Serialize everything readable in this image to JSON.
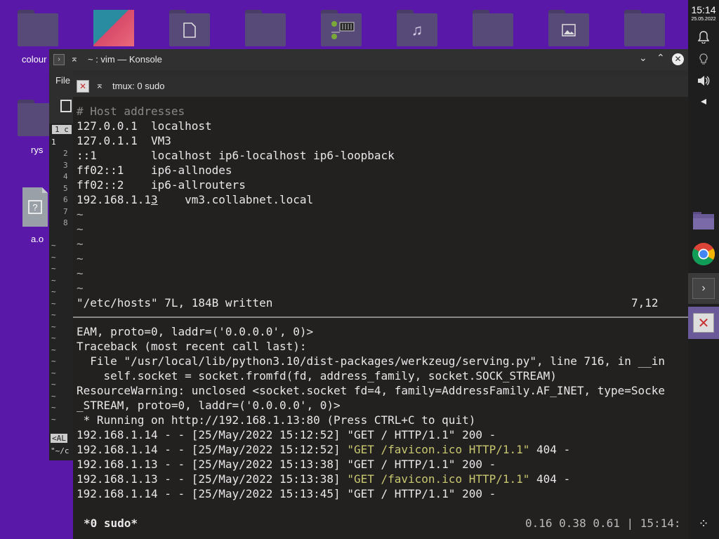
{
  "desktop": {
    "icons": [
      {
        "label": "colour",
        "glyph": ""
      },
      {
        "label": "",
        "glyph": "thumbnail"
      },
      {
        "label": "",
        "glyph": "document-icon"
      },
      {
        "label": "",
        "glyph": ""
      },
      {
        "label": "",
        "glyph": "archive-icon"
      },
      {
        "label": "",
        "glyph": "music-icon"
      },
      {
        "label": "",
        "glyph": ""
      },
      {
        "label": "",
        "glyph": "image-icon"
      },
      {
        "label": "",
        "glyph": ""
      }
    ],
    "left_icons": [
      {
        "label": "rys"
      },
      {
        "label": "a.o"
      }
    ]
  },
  "panel": {
    "time": "15:14",
    "date": "25.05.2022"
  },
  "konsole": {
    "title": "~ : vim — Konsole",
    "menu_file": "File",
    "side_tab": "1 c",
    "side_line1": "1",
    "side_lines": [
      "2",
      "3",
      "4",
      "5",
      "6",
      "7",
      "8"
    ],
    "side_mode": "<AL",
    "side_path": "\"~/c"
  },
  "tmux": {
    "title": "tmux: 0 sudo",
    "vim": {
      "comment": "# Host addresses",
      "lines": [
        "127.0.0.1  localhost",
        "127.0.1.1  VM3",
        "::1        localhost ip6-localhost ip6-loopback",
        "ff02::1    ip6-allnodes",
        "ff02::2    ip6-allrouters"
      ],
      "line6_a": "192.168.1.1",
      "line6_cursor": "3",
      "line6_b": "    vm3.collabnet.local",
      "tilde": "~",
      "status": "\"/etc/hosts\" 7L, 184B written",
      "position": "7,12"
    },
    "server": {
      "pre_lines": [
        "EAM, proto=0, laddr=('0.0.0.0', 0)>",
        "Traceback (most recent call last):",
        "  File \"/usr/local/lib/python3.10/dist-packages/werkzeug/serving.py\", line 716, in __in",
        "    self.socket = socket.fromfd(fd, address_family, socket.SOCK_STREAM)",
        "ResourceWarning: unclosed <socket.socket fd=4, family=AddressFamily.AF_INET, type=Socke",
        "_STREAM, proto=0, laddr=('0.0.0.0', 0)>",
        " * Running on http://192.168.1.13:80 (Press CTRL+C to quit)"
      ],
      "log": [
        {
          "pre": "192.168.1.14 - - [25/May/2022 15:12:52] ",
          "req": "\"GET / HTTP/1.1\"",
          "post": " 200 -",
          "hl": false
        },
        {
          "pre": "192.168.1.14 - - [25/May/2022 15:12:52] ",
          "req": "\"GET /favicon.ico HTTP/1.1\"",
          "post": " 404 -",
          "hl": true
        },
        {
          "pre": "192.168.1.13 - - [25/May/2022 15:13:38] ",
          "req": "\"GET / HTTP/1.1\"",
          "post": " 200 -",
          "hl": false
        },
        {
          "pre": "192.168.1.13 - - [25/May/2022 15:13:38] ",
          "req": "\"GET /favicon.ico HTTP/1.1\"",
          "post": " 404 -",
          "hl": true
        },
        {
          "pre": "192.168.1.14 - - [25/May/2022 15:13:45] ",
          "req": "\"GET / HTTP/1.1\"",
          "post": " 200 -",
          "hl": false
        }
      ]
    },
    "statusbar": {
      "window": "*0 sudo*",
      "load": "0.16 0.38 0.61 | 15:14:"
    }
  }
}
